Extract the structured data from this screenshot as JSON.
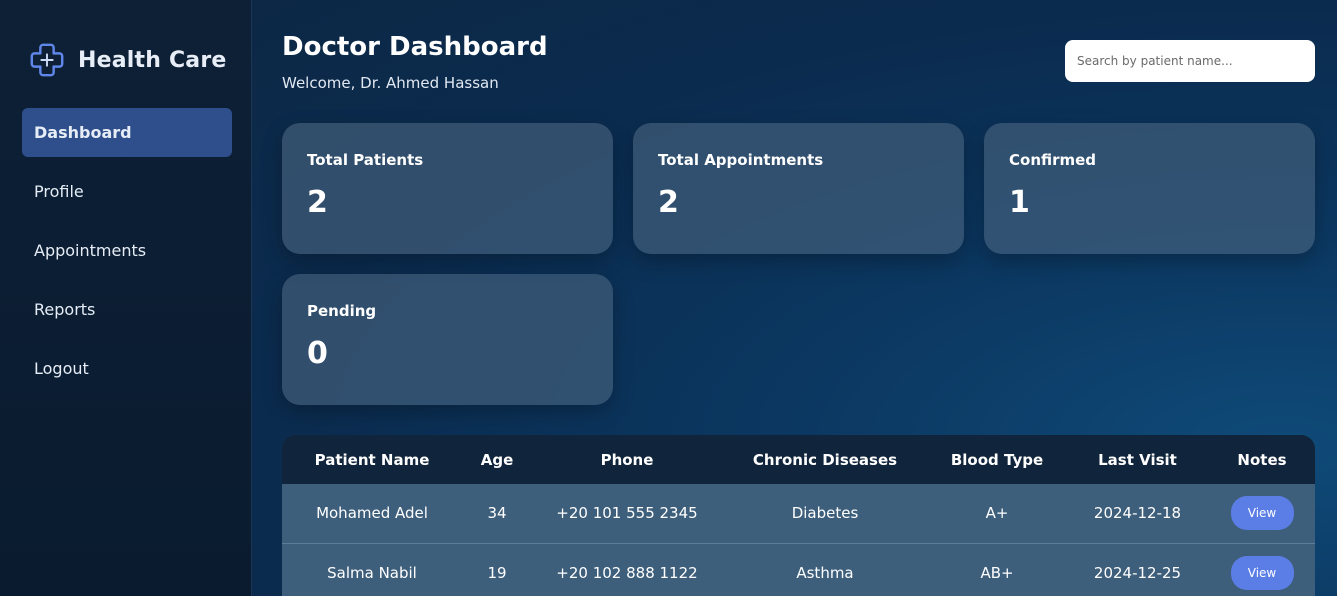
{
  "brand": {
    "name": "Health Care",
    "accent": "#5b7ee6"
  },
  "sidebar": {
    "items": [
      {
        "label": "Dashboard",
        "active": true
      },
      {
        "label": "Profile"
      },
      {
        "label": "Appointments"
      },
      {
        "label": "Reports"
      },
      {
        "label": "Logout"
      }
    ]
  },
  "header": {
    "title": "Doctor Dashboard",
    "welcome": "Welcome, Dr. Ahmed Hassan"
  },
  "search": {
    "placeholder": "Search by patient name..."
  },
  "stats": [
    {
      "label": "Total Patients",
      "value": "2"
    },
    {
      "label": "Total Appointments",
      "value": "2"
    },
    {
      "label": "Confirmed",
      "value": "1"
    },
    {
      "label": "Pending",
      "value": "0"
    }
  ],
  "table": {
    "columns": [
      "Patient Name",
      "Age",
      "Phone",
      "Chronic Diseases",
      "Blood Type",
      "Last Visit",
      "Notes"
    ],
    "rows": [
      {
        "name": "Mohamed Adel",
        "age": "34",
        "phone": "+20 101 555 2345",
        "chronic": "Diabetes",
        "blood": "A+",
        "last_visit": "2024-12-18",
        "notes_label": "View"
      },
      {
        "name": "Salma Nabil",
        "age": "19",
        "phone": "+20 102 888 1122",
        "chronic": "Asthma",
        "blood": "AB+",
        "last_visit": "2024-12-25",
        "notes_label": "View"
      }
    ]
  }
}
